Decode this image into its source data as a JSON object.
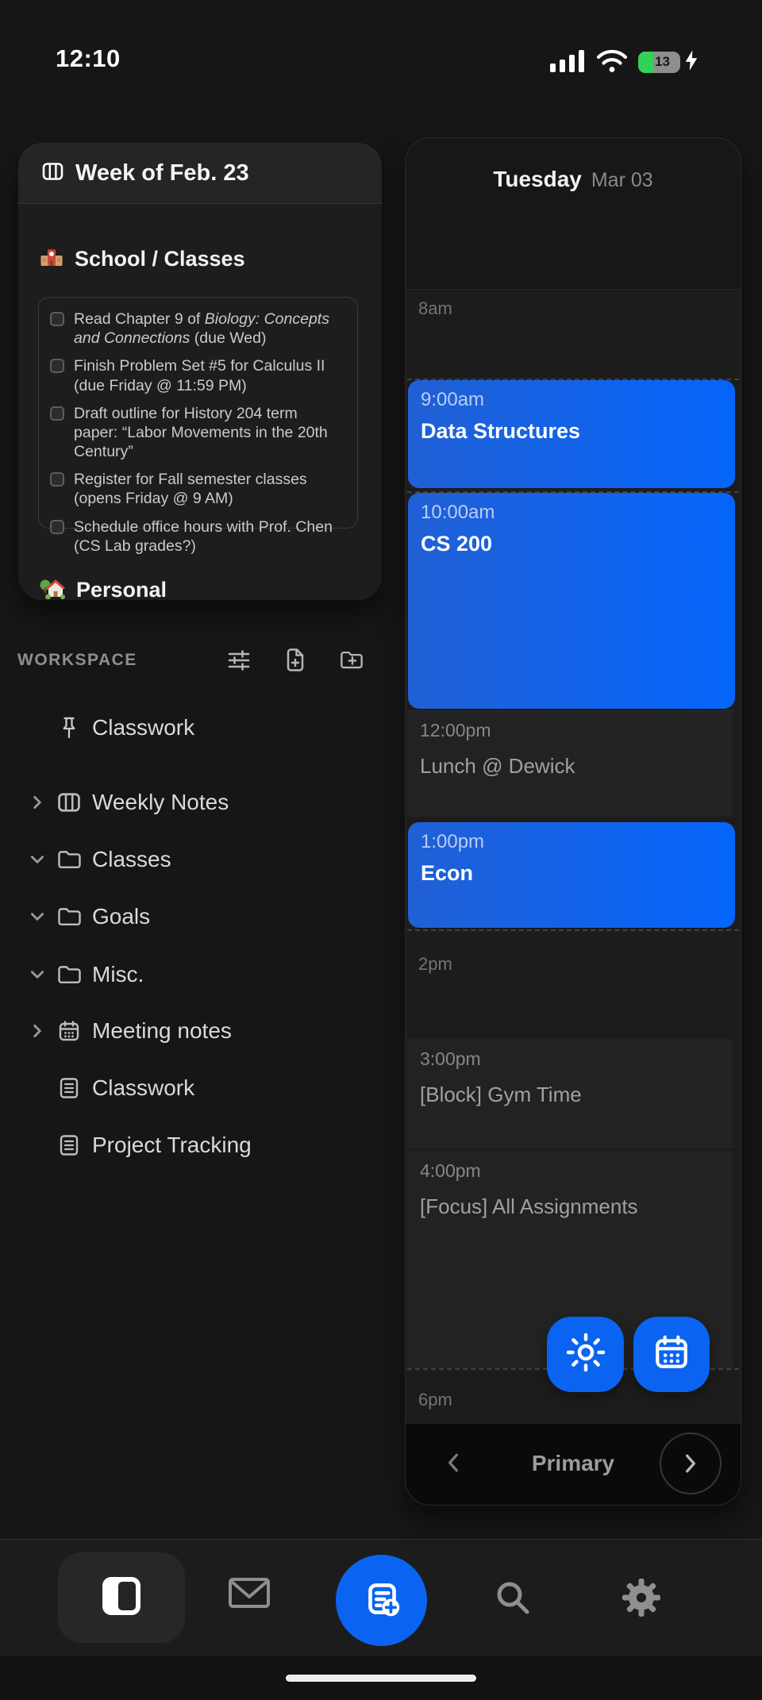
{
  "status_bar": {
    "time": "12:10",
    "battery_percent": "13"
  },
  "weekly_card": {
    "title": "Week of Feb. 23",
    "school_section": {
      "label": "School / Classes",
      "emoji": "school-emoji"
    },
    "personal_section": {
      "label": "Personal",
      "emoji": "house-garden-emoji"
    },
    "tasks": [
      {
        "pre": "Read Chapter 9 of ",
        "italic": "Biology: Concepts and Connections",
        "post": " (due Wed)"
      },
      {
        "pre": "Finish Problem Set #5 for Calculus II (due Friday @ 11:59 PM)",
        "italic": "",
        "post": ""
      },
      {
        "pre": "Draft outline for History 204 term paper: “Labor Movements in the 20th Century”",
        "italic": "",
        "post": ""
      },
      {
        "pre": "Register for Fall semester classes (opens Friday @ 9 AM)",
        "italic": "",
        "post": ""
      },
      {
        "pre": "Schedule office hours with Prof. Chen (CS Lab grades?)",
        "italic": "",
        "post": ""
      }
    ]
  },
  "workspace": {
    "label": "WORKSPACE",
    "toolbar_icons": [
      "sliders-icon",
      "new-file-icon",
      "new-folder-icon"
    ],
    "items": [
      {
        "label": "Classwork",
        "icon": "pin-icon",
        "chevron": "none"
      },
      {
        "label": "Weekly Notes",
        "icon": "table-icon",
        "chevron": "right"
      },
      {
        "label": "Classes",
        "icon": "folder-icon",
        "chevron": "down"
      },
      {
        "label": "Goals",
        "icon": "folder-icon",
        "chevron": "down"
      },
      {
        "label": "Misc.",
        "icon": "folder-icon",
        "chevron": "down"
      },
      {
        "label": "Meeting notes",
        "icon": "calendar-icon",
        "chevron": "right"
      },
      {
        "label": "Classwork",
        "icon": "document-icon",
        "chevron": "none"
      },
      {
        "label": "Project Tracking",
        "icon": "document-icon",
        "chevron": "none"
      }
    ]
  },
  "calendar": {
    "day": "Tuesday",
    "date": "Mar 03",
    "hour_labels": [
      "8am",
      "2pm",
      "6pm"
    ],
    "events": [
      {
        "time": "9:00am",
        "title": "Data Structures",
        "style": "blue"
      },
      {
        "time": "10:00am",
        "title": "CS 200",
        "style": "blue"
      },
      {
        "time": "12:00pm",
        "title": "Lunch @ Dewick",
        "style": "ghost"
      },
      {
        "time": "1:00pm",
        "title": "Econ",
        "style": "blue"
      },
      {
        "time": "3:00pm",
        "title": "[Block] Gym Time",
        "style": "ghost"
      },
      {
        "time": "4:00pm",
        "title": "[Focus] All Assignments",
        "style": "ghost"
      }
    ],
    "fab_icons": [
      "sun-icon",
      "calendar-icon"
    ],
    "footer": {
      "label": "Primary"
    }
  },
  "nav": {
    "icons": [
      "sidebar-panel-icon",
      "mail-icon",
      "new-note-icon",
      "search-icon",
      "gear-icon"
    ]
  },
  "colors": {
    "accent_blue": "#0a64f1",
    "event_gradient_start": "#2160d5",
    "event_gradient_end": "#0565fb",
    "battery_green": "#32d158"
  }
}
